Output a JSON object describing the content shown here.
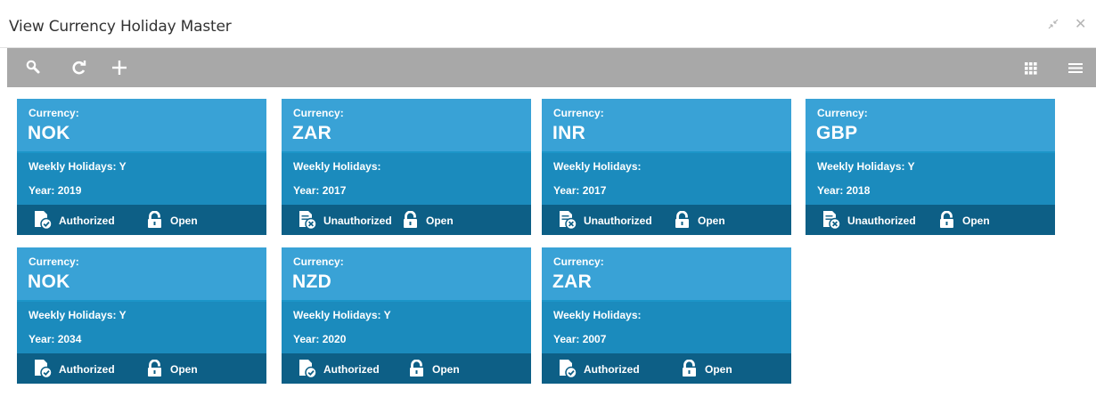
{
  "window": {
    "title": "View Currency Holiday Master",
    "minimize_glyph": "↗↙",
    "close_glyph": "✕"
  },
  "toolbar": {
    "icons": [
      "search-icon",
      "refresh-icon",
      "add-icon",
      "tile-view-icon",
      "list-view-icon"
    ],
    "background": "#a8a8a8"
  },
  "colors": {
    "card_head": "#39a2d6",
    "card_body": "#1b8bbd",
    "card_footer": "#0d5f86"
  },
  "labels": {
    "currency": "Currency:",
    "weekly_holidays": "Weekly Holidays:",
    "year": "Year:"
  },
  "cards": [
    {
      "currency": "NOK",
      "weekly": "Weekly Holidays: Y",
      "year": "Year: 2019",
      "auth": "Authorized",
      "lock": "Open"
    },
    {
      "currency": "ZAR",
      "weekly": "Weekly Holidays:",
      "year": "Year: 2017",
      "auth": "Unauthorized",
      "lock": "Open"
    },
    {
      "currency": "INR",
      "weekly": "Weekly Holidays:",
      "year": "Year: 2017",
      "auth": "Unauthorized",
      "lock": "Open"
    },
    {
      "currency": "GBP",
      "weekly": "Weekly Holidays: Y",
      "year": "Year: 2018",
      "auth": "Unauthorized",
      "lock": "Open"
    },
    {
      "currency": "NOK",
      "weekly": "Weekly Holidays: Y",
      "year": "Year: 2034",
      "auth": "Authorized",
      "lock": "Open"
    },
    {
      "currency": "NZD",
      "weekly": "Weekly Holidays: Y",
      "year": "Year: 2020",
      "auth": "Authorized",
      "lock": "Open"
    },
    {
      "currency": "ZAR",
      "weekly": "Weekly Holidays:",
      "year": "Year: 2007",
      "auth": "Authorized",
      "lock": "Open"
    }
  ]
}
